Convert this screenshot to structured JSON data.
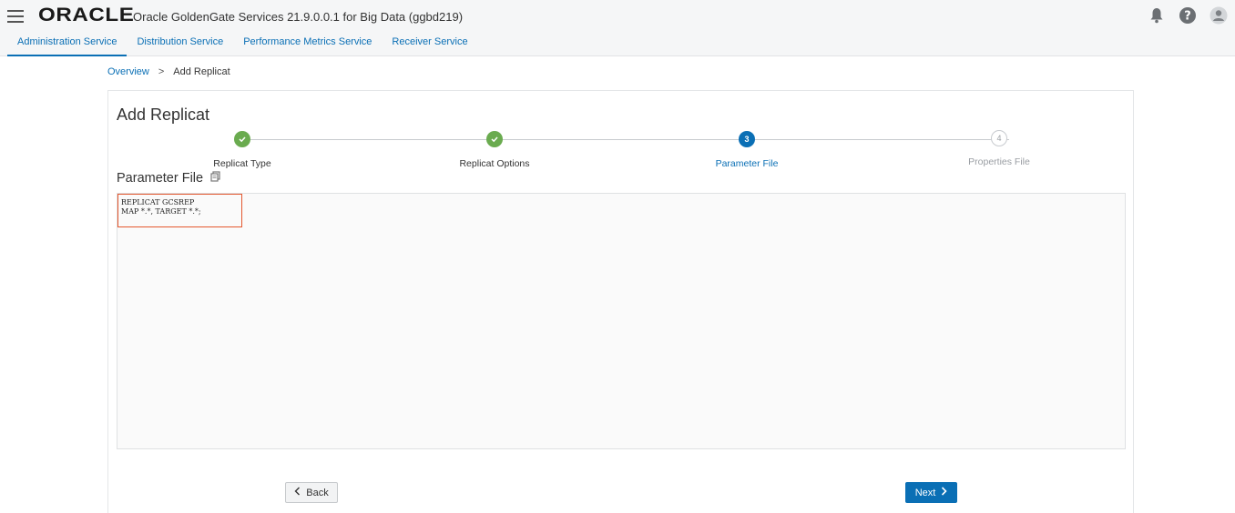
{
  "header": {
    "logo_text": "ORACLE",
    "app_title": "Oracle GoldenGate Services 21.9.0.0.1 for Big Data (ggbd219)",
    "icons": [
      "bell-icon",
      "help-icon",
      "user-icon"
    ]
  },
  "tabs": [
    {
      "label": "Administration Service",
      "active": true
    },
    {
      "label": "Distribution Service",
      "active": false
    },
    {
      "label": "Performance Metrics Service",
      "active": false
    },
    {
      "label": "Receiver Service",
      "active": false
    }
  ],
  "breadcrumb": {
    "overview": "Overview",
    "separator": ">",
    "current": "Add Replicat"
  },
  "page": {
    "title": "Add Replicat"
  },
  "steps": [
    {
      "label": "Replicat Type",
      "status": "complete"
    },
    {
      "label": "Replicat Options",
      "status": "complete"
    },
    {
      "label": "Parameter File",
      "status": "current",
      "number": "3"
    },
    {
      "label": "Properties File",
      "status": "future",
      "number": "4"
    }
  ],
  "parameter_file": {
    "title": "Parameter File",
    "lines": [
      "REPLICAT GCSREP",
      "MAP *.*, TARGET *.*;"
    ]
  },
  "buttons": {
    "back": "Back",
    "next": "Next"
  },
  "colors": {
    "accent": "#0a6fb5",
    "complete": "#6aab4f",
    "highlight": "#e4572e"
  }
}
